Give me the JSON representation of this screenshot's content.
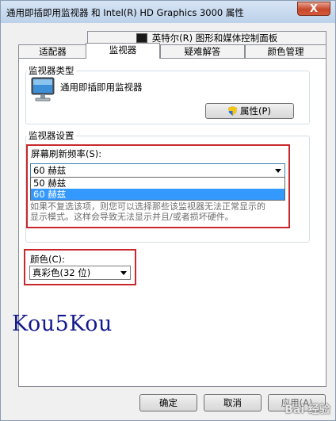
{
  "window": {
    "title": "通用即插即用监视器 和 Intel(R) HD Graphics 3000 属性",
    "close_label": "X"
  },
  "tabs": {
    "top": {
      "intel": "英特尔(R) 图形和媒体控制面板"
    },
    "row": [
      {
        "label": "适配器"
      },
      {
        "label": "监视器"
      },
      {
        "label": "疑难解答"
      },
      {
        "label": "颜色管理"
      }
    ],
    "active": "监视器"
  },
  "monitor_type": {
    "group_label": "监视器类型",
    "name": "通用即插即用监视器",
    "properties_button": "属性(P)"
  },
  "monitor_settings": {
    "group_label": "监视器设置",
    "refresh_label": "屏幕刷新频率(S):",
    "refresh_selected": "60 赫兹",
    "refresh_options": [
      "50 赫兹",
      "60 赫兹"
    ],
    "warning_line1": "如果不复选该项，则您可以选择那些该监视器无法正常显示的",
    "warning_line2": "显示模式。这样会导致无法显示并且/或者损坏硬件。"
  },
  "color": {
    "label": "颜色(C):",
    "selected": "真彩色(32 位)"
  },
  "overlay_text": "Kou5Kou",
  "footer": {
    "ok": "确定",
    "cancel": "取消",
    "apply": "应用(A)",
    "watermark": "Bai 经验"
  },
  "colors": {
    "highlight_red": "#c8282d",
    "selection_blue": "#3399ff",
    "overlay_text_blue": "#141a8c"
  }
}
